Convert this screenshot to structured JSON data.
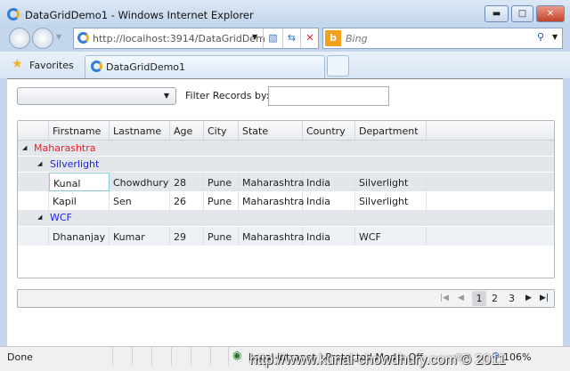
{
  "window": {
    "title": "DataGridDemo1 - Windows Internet Explorer"
  },
  "nav": {
    "address": "http://localhost:3914/DataGridDem",
    "address_host": "localhost",
    "search_placeholder": "Bing"
  },
  "tabs": {
    "favorites": "Favorites",
    "active_tab": "DataGridDemo1"
  },
  "toolbar": {
    "filter_label": "Filter Records by:",
    "filter_value": "",
    "combo_value": ""
  },
  "grid": {
    "columns": [
      "Firstname",
      "Lastname",
      "Age",
      "City",
      "State",
      "Country",
      "Department"
    ],
    "groups": [
      {
        "name": "Maharashtra",
        "color": "#e8202a"
      },
      {
        "name": "Silverlight",
        "color": "#2020e0"
      },
      {
        "name": "WCF",
        "color": "#2020e0"
      }
    ],
    "rows": [
      [
        "Kunal",
        "Chowdhury",
        "28",
        "Pune",
        "Maharashtra",
        "India",
        "Silverlight"
      ],
      [
        "Kapil",
        "Sen",
        "26",
        "Pune",
        "Maharashtra",
        "India",
        "Silverlight"
      ],
      [
        "Dhananjay",
        "Kumar",
        "29",
        "Pune",
        "Maharashtra",
        "India",
        "WCF"
      ]
    ]
  },
  "pager": {
    "pages": [
      "1",
      "2",
      "3"
    ],
    "current": "1"
  },
  "status": {
    "text": "Done",
    "zone": "Local intranet | Protected Mode: Off",
    "zoom": "106%"
  },
  "watermark": "http://www.kunal-chowdhury.com © 2011"
}
